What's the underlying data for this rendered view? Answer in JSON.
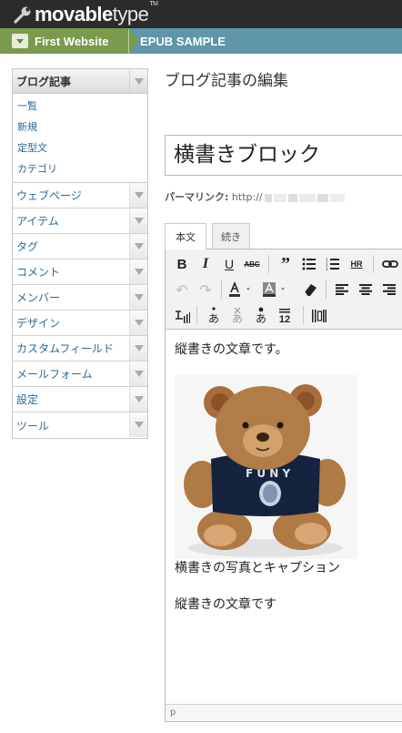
{
  "header": {
    "logo_bold": "movable",
    "logo_light": "type",
    "logo_tm": "TM"
  },
  "breadcrumb": {
    "site": "First Website",
    "blog": "EPUB SAMPLE"
  },
  "sidebar": {
    "active_section": "ブログ記事",
    "active_items": [
      "一覧",
      "新規",
      "定型文",
      "カテゴリ"
    ],
    "items": [
      {
        "label": "ウェブページ"
      },
      {
        "label": "アイテム"
      },
      {
        "label": "タグ"
      },
      {
        "label": "コメント"
      },
      {
        "label": "メンバー"
      },
      {
        "label": "デザイン"
      },
      {
        "label": "カスタムフィールド"
      },
      {
        "label": "メールフォーム"
      },
      {
        "label": "設定"
      },
      {
        "label": "ツール"
      }
    ]
  },
  "main": {
    "page_title": "ブログ記事の編集",
    "title_value": "横書きブロック",
    "permalink_label": "パーマリンク:",
    "permalink_url": "http://",
    "tabs": [
      {
        "label": "本文"
      },
      {
        "label": "続き"
      }
    ]
  },
  "toolbar": {
    "bold": "B",
    "italic": "I",
    "underline": "U",
    "strike": "ABC",
    "hr": "HR",
    "ruby_12": "12"
  },
  "content": {
    "para1": "縦書きの文章です。",
    "caption": "横書きの写真とキャプション",
    "para2": "縦書きの文章です"
  },
  "statusbar": {
    "path": "p"
  }
}
